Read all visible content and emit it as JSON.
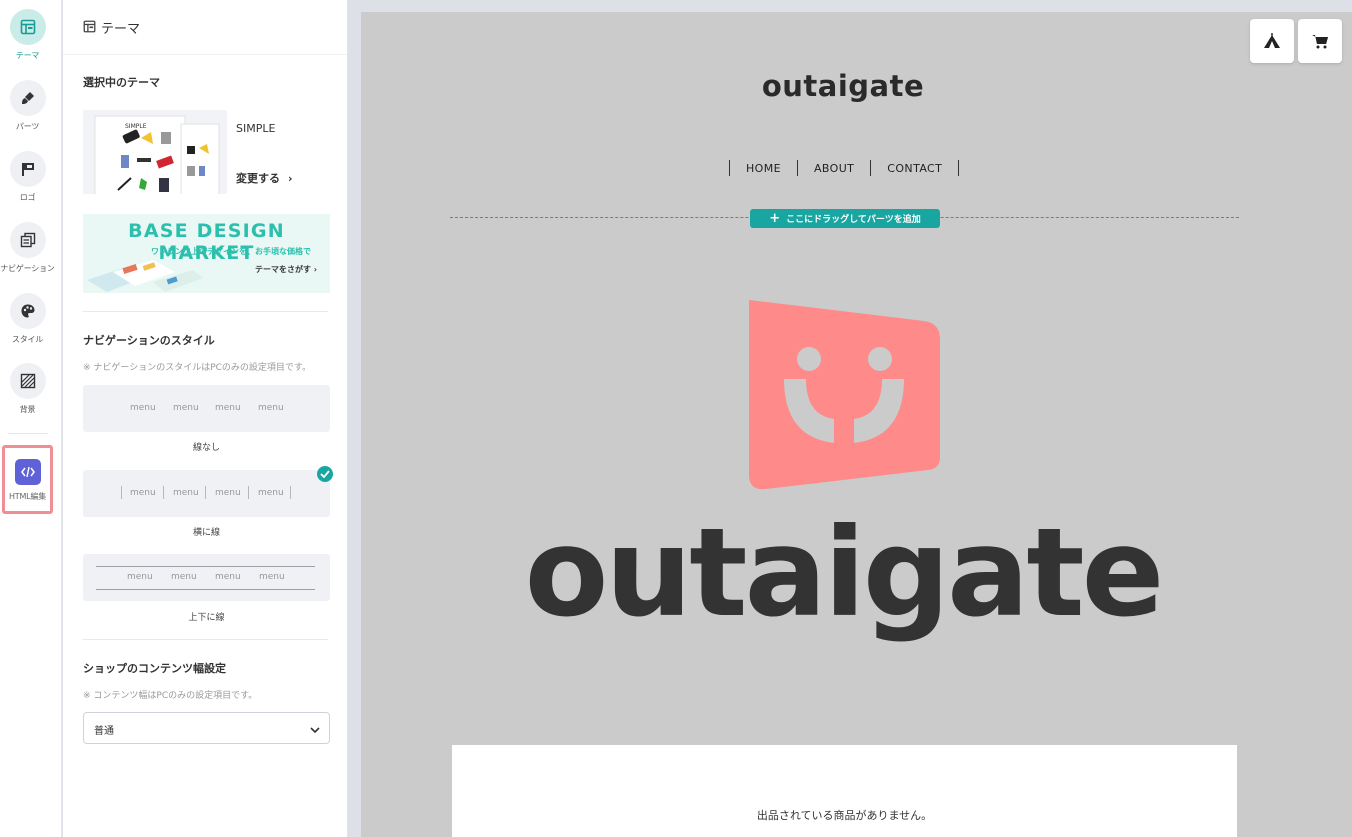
{
  "sidebar": {
    "items": [
      {
        "label": "テーマ",
        "icon": "theme-icon",
        "active": true
      },
      {
        "label": "パーツ",
        "icon": "brush-icon"
      },
      {
        "label": "ロゴ",
        "icon": "flag-icon"
      },
      {
        "label": "ナビゲーション",
        "icon": "navigation-icon"
      },
      {
        "label": "スタイル",
        "icon": "palette-icon"
      },
      {
        "label": "背景",
        "icon": "background-pattern-icon"
      }
    ],
    "html_edit": {
      "label": "HTML編集",
      "icon": "code-icon"
    }
  },
  "panel": {
    "title": "テーマ",
    "current_theme": {
      "heading": "選択中のテーマ",
      "name": "SIMPLE",
      "change_label": "変更する",
      "thumbnail_title": "SIMPLE"
    },
    "banner": {
      "title": "BASE DESIGN MARKET",
      "subtitle": "ワンランク上のデザインを、お手頃な価格で",
      "link": "テーマをさがす"
    },
    "nav_style": {
      "heading": "ナビゲーションのスタイル",
      "note": "※ ナビゲーションのスタイルはPCのみの設定項目です。",
      "menu_word": "menu",
      "options": [
        {
          "label": "線なし",
          "selected": false
        },
        {
          "label": "横に線",
          "selected": true
        },
        {
          "label": "上下に線",
          "selected": false
        }
      ]
    },
    "content_width": {
      "heading": "ショップのコンテンツ幅設定",
      "note": "※ コンテンツ幅はPCのみの設定項目です。",
      "value": "普通"
    }
  },
  "preview": {
    "shop_title": "outaigate",
    "nav": [
      "HOME",
      "ABOUT",
      "CONTACT"
    ],
    "drop_zone_label": "ここにドラッグしてパーツを追加",
    "logo_wordmark": "outaigate",
    "empty_message": "出品されている商品がありません。",
    "top_icons": [
      "tent-icon",
      "cart-icon"
    ]
  },
  "colors": {
    "accent": "#1aa6a0",
    "logo_pink": "#fe8a8a",
    "logo_dark": "#333333",
    "preview_bg": "#cbcbcb",
    "html_edit_button": "#5f62d6",
    "highlight_border": "#f08f93"
  }
}
